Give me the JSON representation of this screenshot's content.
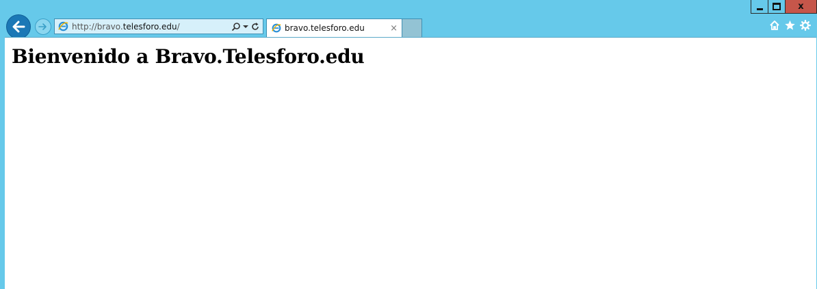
{
  "window": {
    "controls": [
      "minimize",
      "maximize",
      "close"
    ],
    "close_glyph": "x"
  },
  "navigation": {
    "back_icon": "back-arrow-icon",
    "forward_icon": "forward-arrow-icon"
  },
  "address_bar": {
    "url_prefix": "http://bravo.",
    "url_domain": "telesforo.edu",
    "url_suffix": "/",
    "tools": [
      "search-icon",
      "dropdown-icon",
      "refresh-icon"
    ]
  },
  "tabs": [
    {
      "title": "bravo.telesforo.edu",
      "active": true,
      "close_glyph": "×"
    }
  ],
  "toolbar_right": [
    "home-icon",
    "favorites-star-icon",
    "settings-gear-icon"
  ],
  "page": {
    "heading": "Bienvenido a Bravo.Telesforo.edu"
  },
  "colors": {
    "chrome": "#66c9ea",
    "close_button": "#c6564a",
    "back_button": "#1b78b6",
    "content_bg": "#ffffff"
  }
}
